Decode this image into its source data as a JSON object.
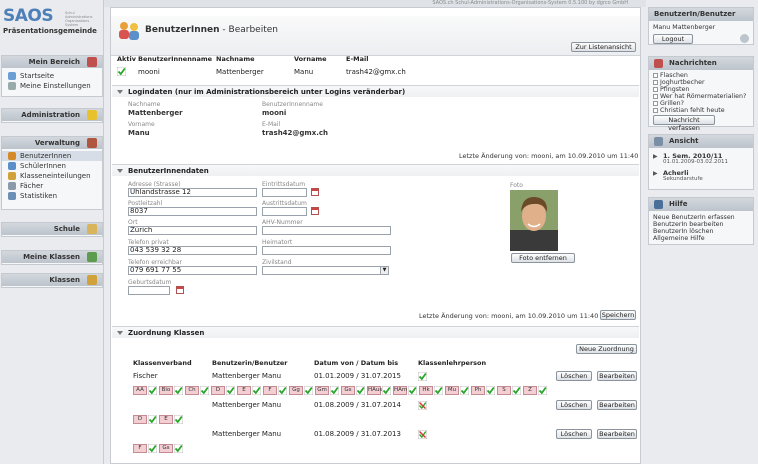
{
  "top_note": "SAOS.ch Schul-Administrations-Organisations-System 0.5.100 by dgrco GmbH",
  "logo": {
    "text": "SAOS",
    "fine": "Schul Administrations Organisations System",
    "subtitle": "Präsentationsgemeinde"
  },
  "left": {
    "mein_bereich": {
      "title": "Mein Bereich",
      "items": [
        "Startseite",
        "Meine Einstellungen"
      ]
    },
    "administration": {
      "title": "Administration"
    },
    "verwaltung": {
      "title": "Verwaltung",
      "items": [
        "BenutzerInnen",
        "SchülerInnen",
        "Klasseneinteilungen",
        "Fächer",
        "Statistiken"
      ]
    },
    "schule": {
      "title": "Schule"
    },
    "meine_klassen": {
      "title": "Meine Klassen"
    },
    "klassen": {
      "title": "Klassen"
    }
  },
  "main": {
    "title": "BenutzerInnen",
    "title_suffix": "- Bearbeiten",
    "back_button": "Zur Listenansicht",
    "table_headers": [
      "Aktiv",
      "BenutzerInnenname",
      "Nachname",
      "Vorname",
      "E-Mail"
    ],
    "user_row": [
      "mooni",
      "Mattenberger",
      "Manu",
      "trash42@gmx.ch"
    ],
    "login_section": "Logindaten (nur im Administrationsbereich unter Logins veränderbar)",
    "login": {
      "nachname_label": "Nachname",
      "nachname": "Mattenberger",
      "username_label": "BenutzerInnenname",
      "username": "mooni",
      "vorname_label": "Vorname",
      "vorname": "Manu",
      "email_label": "E-Mail",
      "email": "trash42@gmx.ch"
    },
    "last_change_1": "Letzte Änderung von: mooni, am 10.09.2010 um 11:40",
    "data_section": "BenutzerInnendaten",
    "form": {
      "adresse_label": "Adresse (Strasse)",
      "adresse": "Uhlandstrasse 12",
      "eintritt_label": "Eintrittsdatum",
      "plz_label": "Postleitzahl",
      "plz": "8037",
      "austritt_label": "Austrittsdatum",
      "ort_label": "Ort",
      "ort": "Zürich",
      "ahv_label": "AHV-Nummer",
      "tel_priv_label": "Telefon privat",
      "tel_priv": "043 539 32 28",
      "heimatort_label": "Heimatort",
      "tel_erreich_label": "Telefon erreichbar",
      "tel_erreich": "079 691 77 55",
      "zivilstand_label": "Zivilstand",
      "geburt_label": "Geburtsdatum",
      "foto_label": "Foto",
      "foto_button": "Foto entfernen"
    },
    "last_change_2": "Letzte Änderung von: mooni, am 10.09.2010 um 11:40",
    "save_button": "Speichern",
    "klassen_section": "Zuordnung Klassen",
    "new_button": "Neue Zuordnung",
    "klassen_headers": [
      "Klassenverband",
      "Benutzerin/Benutzer",
      "Datum von / Datum bis",
      "Klassenlehrperson"
    ],
    "rows": [
      {
        "klasse": "Fischer",
        "user": "Mattenberger Manu",
        "dates": "01.01.2009 / 31.07.2015",
        "lehrperson": true,
        "tags": [
          "AA",
          "Bio",
          "Ch",
          "D",
          "E",
          "F",
          "Gg",
          "Gm",
          "Gs",
          "HAus",
          "HAm",
          "Hk",
          "Mu",
          "Ph",
          "S",
          "Z"
        ]
      },
      {
        "klasse": "",
        "user": "Mattenberger Manu",
        "dates": "01.08.2009 / 31.07.2014",
        "lehrperson": false,
        "tags": [
          "D",
          "E"
        ]
      },
      {
        "klasse": "",
        "user": "Mattenberger Manu",
        "dates": "01.08.2009 / 31.07.2013",
        "lehrperson": false,
        "tags": [
          "F",
          "Gs"
        ]
      }
    ],
    "row_btn_delete": "Löschen",
    "row_btn_edit": "Bearbeiten"
  },
  "right": {
    "user_box": {
      "title": "BenutzerIn/Benutzer",
      "name": "Manu Mattenberger",
      "logout": "Logout"
    },
    "nachrichten": {
      "title": "Nachrichten",
      "items": [
        "Flaschen",
        "Joghurtbecher",
        "Pfingsten",
        "Wer hat Römermaterialien?",
        "Grillen?",
        "Christian fehlt heute"
      ],
      "button": "Nachricht verfassen"
    },
    "ansicht": {
      "title": "Ansicht",
      "sem": "1. Sem. 2010/11",
      "sem_dates": "01.01.2009-03.02.2011",
      "klasse": "Acherli",
      "stufe": "Sekundarstufe"
    },
    "hilfe": {
      "title": "Hilfe",
      "items": [
        "Neue BenutzerIn erfassen",
        "BenutzerIn bearbeiten",
        "BenutzerIn löschen",
        "Allgemeine Hilfe"
      ]
    }
  },
  "colors": {
    "accent": "#4d7fb8",
    "check": "#2aa52a",
    "tag_bg": "#f3cfd4"
  }
}
